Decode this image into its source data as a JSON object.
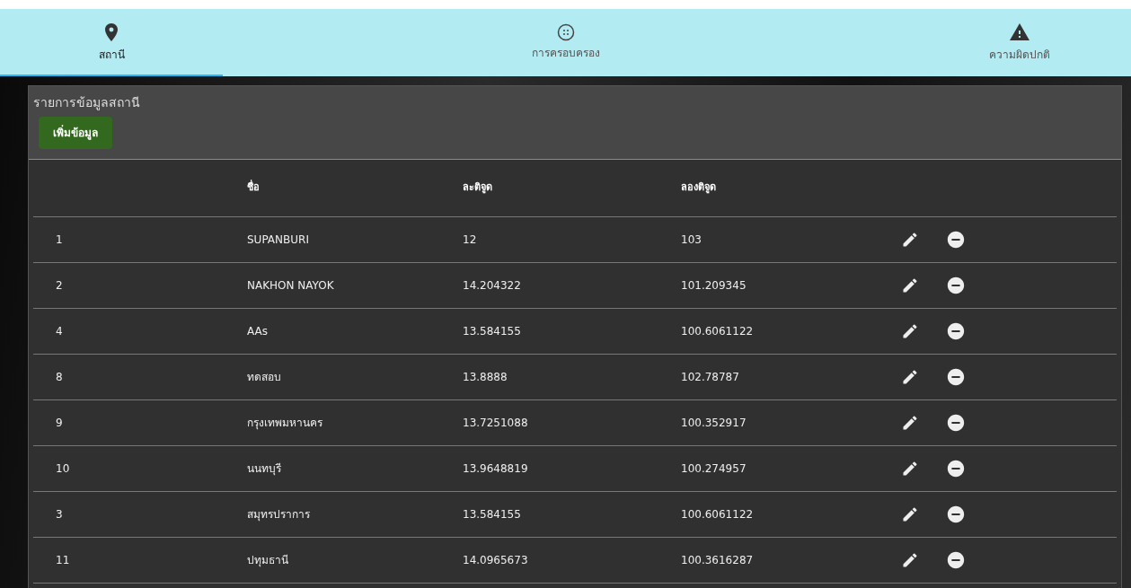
{
  "tabs": [
    {
      "label": "สถานี",
      "kind": "station",
      "selected": true
    },
    {
      "label": "การครอบครอง",
      "kind": "occupancy",
      "selected": false
    },
    {
      "label": "ความผิดปกติ",
      "kind": "alert",
      "selected": false
    }
  ],
  "panel": {
    "title": "รายการข้อมูลสถานี",
    "add_button": "เพิ่มข้อมูล"
  },
  "table": {
    "columns": [
      "",
      "ชื่อ",
      "ละติจูด",
      "ลองติจูด"
    ],
    "rows": [
      {
        "id": "1",
        "name": "SUPANBURI",
        "lat": "12",
        "lon": "103"
      },
      {
        "id": "2",
        "name": "NAKHON NAYOK",
        "lat": "14.204322",
        "lon": "101.209345"
      },
      {
        "id": "4",
        "name": "AAs",
        "lat": "13.584155",
        "lon": "100.6061122"
      },
      {
        "id": "8",
        "name": "ทดสอบ",
        "lat": "13.8888",
        "lon": "102.78787"
      },
      {
        "id": "9",
        "name": "กรุงเทพมหานคร",
        "lat": "13.7251088",
        "lon": "100.352917"
      },
      {
        "id": "10",
        "name": "นนทบุรี",
        "lat": "13.9648819",
        "lon": "100.274957"
      },
      {
        "id": "3",
        "name": "สมุทรปราการ",
        "lat": "13.584155",
        "lon": "100.6061122"
      },
      {
        "id": "11",
        "name": "ปทุมธานี",
        "lat": "14.0965673",
        "lon": "100.3616287"
      }
    ]
  }
}
